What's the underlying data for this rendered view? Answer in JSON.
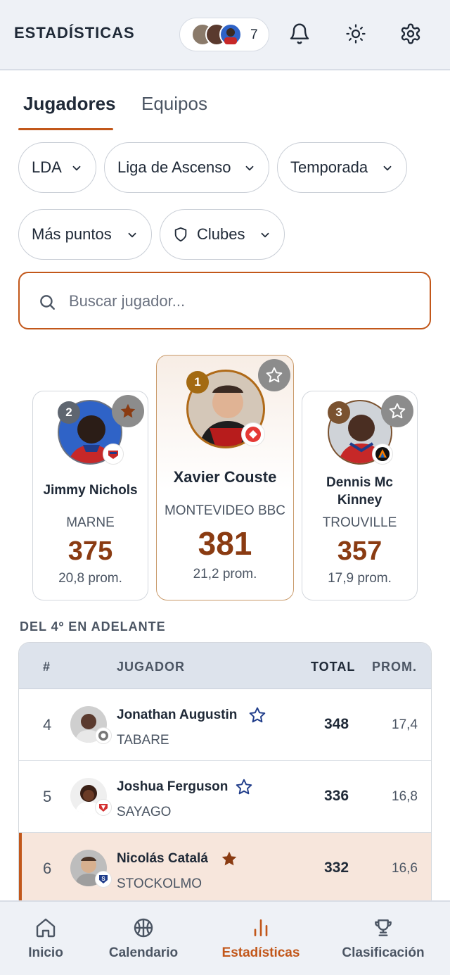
{
  "header": {
    "title": "ESTADÍSTICAS",
    "followers_count": "7",
    "icons": [
      "bell-icon",
      "sun-icon",
      "gear-icon"
    ]
  },
  "tabs": [
    {
      "label": "Jugadores",
      "active": true
    },
    {
      "label": "Equipos",
      "active": false
    }
  ],
  "filters": {
    "league": "LDA",
    "division": "Liga de Ascenso",
    "season": "Temporada",
    "metric": "Más puntos",
    "clubs": "Clubes"
  },
  "search": {
    "placeholder": "Buscar jugador...",
    "value": ""
  },
  "podium": [
    {
      "rank": "2",
      "name": "Jimmy Nichols",
      "team": "MARNE",
      "total": "375",
      "avg": "20,8 prom.",
      "favorite": true
    },
    {
      "rank": "1",
      "name": "Xavier Couste",
      "team": "MONTEVIDEO BBC",
      "total": "381",
      "avg": "21,2 prom.",
      "favorite": false
    },
    {
      "rank": "3",
      "name": "Dennis Mc Kinney",
      "team": "TROUVILLE",
      "total": "357",
      "avg": "17,9 prom.",
      "favorite": false
    }
  ],
  "rest_section_label": "DEL 4º EN ADELANTE",
  "table": {
    "headers": {
      "rank": "#",
      "player": "JUGADOR",
      "total": "TOTAL",
      "avg": "PROM."
    },
    "rows": [
      {
        "rank": "4",
        "name": "Jonathan Augustin",
        "team": "TABARE",
        "total": "348",
        "avg": "17,4",
        "favorite": false,
        "highlight": false
      },
      {
        "rank": "5",
        "name": "Joshua Ferguson",
        "team": "SAYAGO",
        "total": "336",
        "avg": "16,8",
        "favorite": false,
        "highlight": false
      },
      {
        "rank": "6",
        "name": "Nicolás Catalá",
        "team": "STOCKOLMO",
        "total": "332",
        "avg": "16,6",
        "favorite": true,
        "highlight": true
      }
    ]
  },
  "bottom_nav": [
    {
      "label": "Inicio",
      "icon": "home-icon",
      "active": false
    },
    {
      "label": "Calendario",
      "icon": "basketball-icon",
      "active": false
    },
    {
      "label": "Estadísticas",
      "icon": "bar-chart-icon",
      "active": true
    },
    {
      "label": "Clasificación",
      "icon": "trophy-icon",
      "active": false
    }
  ],
  "colors": {
    "accent": "#c2571a",
    "total_text": "#8a3b12",
    "header_bg": "#eef1f6",
    "highlight_row": "#f7e6dc",
    "gold_rank": "#a36a12",
    "silver_rank": "#5f6670",
    "bronze_rank": "#7a5230"
  }
}
